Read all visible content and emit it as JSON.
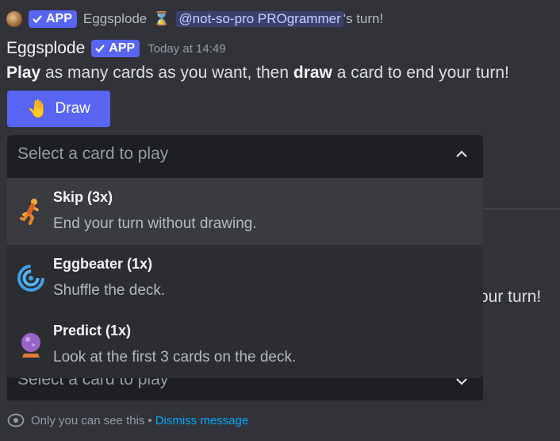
{
  "reply": {
    "app_badge": "APP",
    "author": "Eggsplode",
    "hourglass": "⌛",
    "mention": "@not-so-pro PROgrammer",
    "suffix": "'s turn!"
  },
  "message": {
    "author": "Eggsplode",
    "app_badge": "APP",
    "timestamp": "Today at 14:49",
    "text_play": "Play",
    "text_mid": " as many cards as you want, then ",
    "text_draw": "draw",
    "text_end": " a card to end your turn!",
    "draw_button": {
      "emoji": "🤚",
      "label": "Draw"
    }
  },
  "select": {
    "placeholder": "Select a card to play",
    "options": [
      {
        "title": "Skip (3x)",
        "description": "End your turn without drawing.",
        "icon": "runner-icon"
      },
      {
        "title": "Eggbeater (1x)",
        "description": "Shuffle the deck.",
        "icon": "cyclone-icon"
      },
      {
        "title": "Predict (1x)",
        "description": "Look at the first 3 cards on the deck.",
        "icon": "crystal-ball-icon"
      }
    ]
  },
  "background": {
    "text_end_fragment": "our turn!",
    "select_placeholder": "Select a card to play",
    "ephemeral_note": "Only you can see this",
    "separator": "•",
    "dismiss": "Dismiss message"
  },
  "colors": {
    "background": "#323339",
    "blurple": "#5865f2",
    "link": "#00a8fc"
  }
}
